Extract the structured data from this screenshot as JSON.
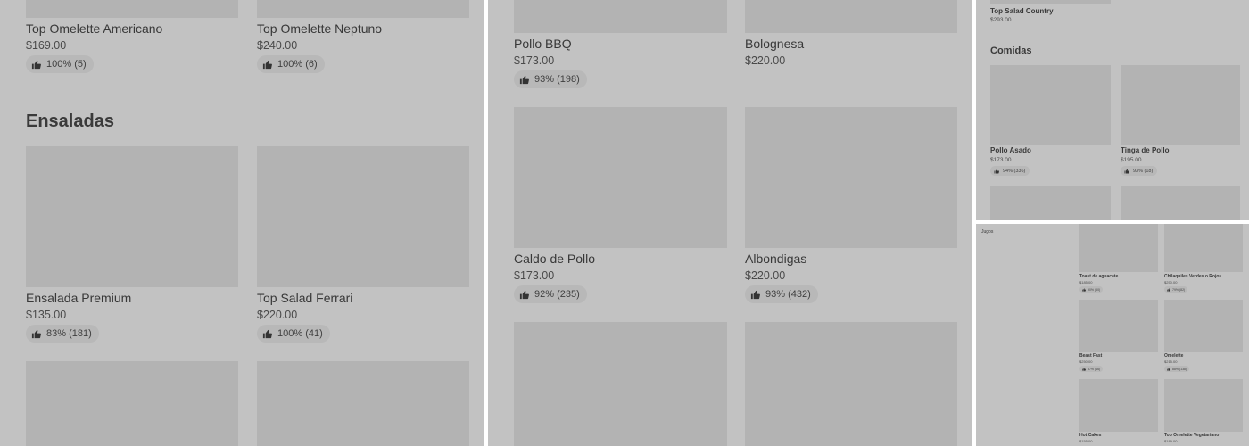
{
  "panel_a": {
    "items_top": [
      {
        "name": "Top Omelette Americano",
        "price": "$169.00",
        "rating": "100% (5)"
      },
      {
        "name": "Top Omelette Neptuno",
        "price": "$240.00",
        "rating": "100% (6)"
      }
    ],
    "section_title": "Ensaladas",
    "items_section": [
      {
        "name": "Ensalada Premium",
        "price": "$135.00",
        "rating": "83% (181)"
      },
      {
        "name": "Top Salad Ferrari",
        "price": "$220.00",
        "rating": "100% (41)"
      }
    ]
  },
  "panel_b": {
    "items_row1": [
      {
        "name": "Pollo BBQ",
        "price": "$173.00",
        "rating": "93% (198)"
      },
      {
        "name": "Bolognesa",
        "price": "$220.00"
      }
    ],
    "items_row2": [
      {
        "name": "Caldo de Pollo",
        "price": "$173.00",
        "rating": "92% (235)"
      },
      {
        "name": "Albondigas",
        "price": "$220.00",
        "rating": "93% (432)"
      }
    ]
  },
  "panel_c": {
    "top_item": {
      "name": "Top Salad Country",
      "price": "$293.00"
    },
    "section_title": "Comidas",
    "items": [
      {
        "name": "Pollo Asado",
        "price": "$173.00",
        "rating": "94% (336)"
      },
      {
        "name": "Tinga de Pollo",
        "price": "$195.00",
        "rating": "93% (18)"
      }
    ]
  },
  "panel_d": {
    "side_label": "Jugos",
    "items": [
      {
        "name": "Toast de aguacate",
        "price": "$185.00",
        "rating": "90% (60)"
      },
      {
        "name": "Chilaquiles Verdes o Rojos",
        "price": "$250.00",
        "rating": "79% (82)"
      },
      {
        "name": "Beast Fast",
        "price": "$250.00",
        "rating": "87% (16)"
      },
      {
        "name": "Omelette",
        "price": "$215.00",
        "rating": "88% (138)"
      },
      {
        "name": "Hot Cakes",
        "price": "$155.00"
      },
      {
        "name": "Top Omelette Vegetariano",
        "price": "$189.00"
      }
    ]
  },
  "icons": {
    "rating": "thumbs-up-icon"
  },
  "colors": {
    "overlay": "#c2c2c2",
    "thumb": "#b3b3b3",
    "chip": "#b8b8b8",
    "divider": "#ffffff"
  }
}
